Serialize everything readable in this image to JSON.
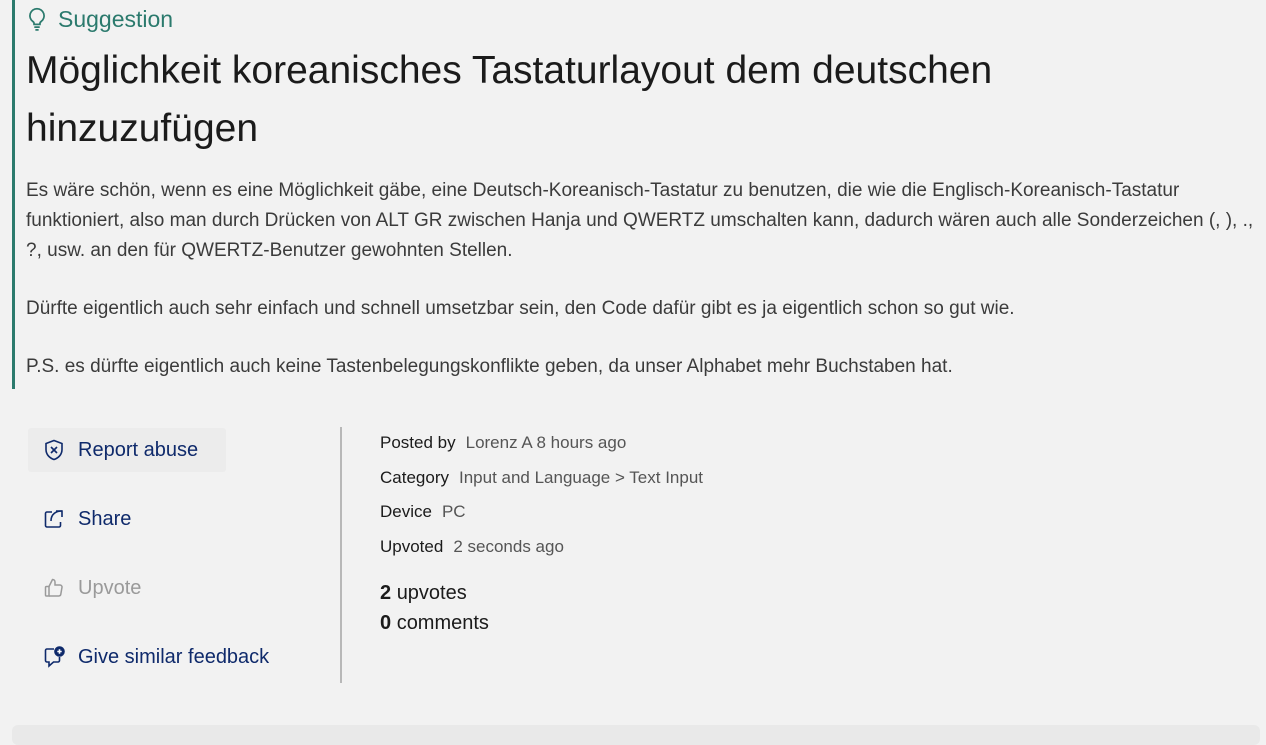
{
  "post": {
    "type_label": "Suggestion",
    "title": "Möglichkeit koreanisches Tastaturlayout dem deutschen hinzuzufügen",
    "paragraphs": [
      "Es wäre schön, wenn es eine Möglichkeit gäbe, eine Deutsch-Koreanisch-Tastatur zu benutzen, die wie die Englisch-Koreanisch-Tastatur funktioniert, also man durch Drücken von ALT GR zwischen Hanja und QWERTZ umschalten kann, dadurch wären auch alle Sonderzeichen (, ), ., ?, usw. an den für QWERTZ-Benutzer gewohnten Stellen.",
      "Dürfte eigentlich auch sehr einfach und schnell umsetzbar sein, den Code dafür gibt es ja eigentlich schon so gut wie.",
      "P.S. es dürfte eigentlich auch keine Tastenbelegungskonflikte geben, da unser Alphabet mehr Buchstaben hat."
    ]
  },
  "actions": {
    "report": "Report abuse",
    "share": "Share",
    "upvote": "Upvote",
    "similar": "Give similar feedback"
  },
  "meta": {
    "posted_by_key": "Posted by",
    "posted_by_val": "Lorenz A 8 hours ago",
    "category_key": "Category",
    "category_val": "Input and Language > Text Input",
    "device_key": "Device",
    "device_val": "PC",
    "upvoted_key": "Upvoted",
    "upvoted_val": "2 seconds ago"
  },
  "counts": {
    "upvotes_num": "2",
    "upvotes_label": "upvotes",
    "comments_num": "0",
    "comments_label": "comments"
  },
  "icons": {
    "type": "lightbulb-icon",
    "report": "shield-x-icon",
    "share": "share-icon",
    "upvote": "thumbs-up-icon",
    "similar": "feedback-add-icon"
  },
  "colors": {
    "accent": "#2b7a6d",
    "link": "#0f2a6b",
    "disabled": "#9a9a9a"
  }
}
